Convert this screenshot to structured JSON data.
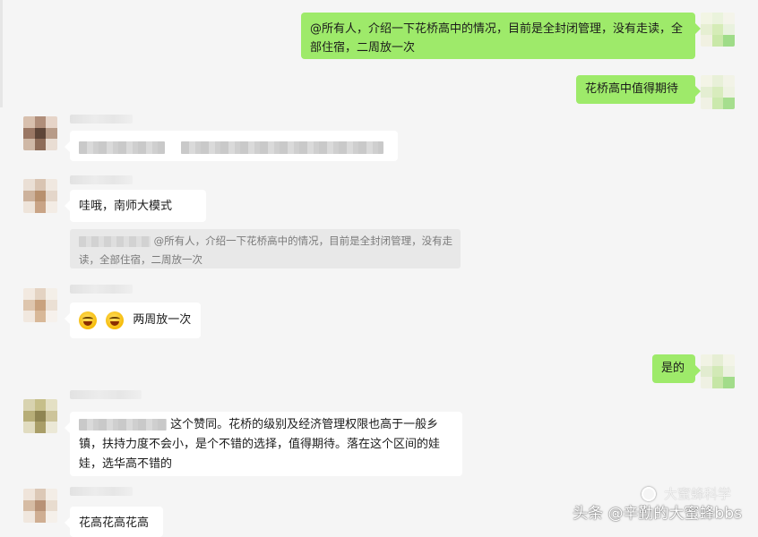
{
  "messages": {
    "m1_text": "@所有人，介绍一下花桥高中的情况，目前是全封闭管理，没有走读，全部住宿，二周放一次",
    "m2_text": "花桥高中值得期待",
    "m4_text": "哇哦，南师大模式",
    "m4_quote": "@所有人，介绍一下花桥高中的情况，目前是全封闭管理，没有走读，全部住宿，二周放一次",
    "m5_text": "两周放一次",
    "m6_text": "是的",
    "m7_text": "这个赞同。花桥的级别及经济管理权限也高于一般乡镇，扶持力度不会小，是个不错的选择，值得期待。落在这个区间的娃娃，选华高不错的",
    "m8_text": "花高花高花高"
  },
  "watermark": {
    "text": "头条 @辛勤的大蜜蜂bbs",
    "overlay": "大蜜蜂科学"
  },
  "colors": {
    "sent_bubble": "#9eea6a",
    "received_bubble": "#ffffff",
    "background": "#f5f5f5",
    "quote_bg": "#e8e8e8"
  }
}
